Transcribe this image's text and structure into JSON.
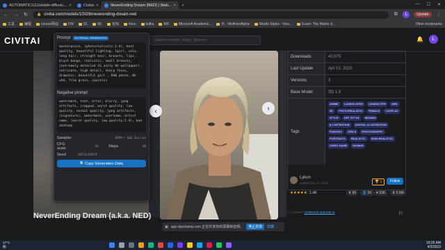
{
  "browser": {
    "tabs": [
      {
        "title": "AUTOMATIC1111/stable-diffusio..."
      },
      {
        "title": "Civitai"
      },
      {
        "title": "NeverEnding Dream (NED) | Stab..."
      }
    ],
    "url": "civitai.com/models/10028/neverending-dream-ned",
    "update_label": "Update",
    "profile_initial": "L",
    "bookmarks": [
      "工具",
      "编程",
      "course网站",
      "FW",
      "DL",
      "ML",
      "论坛",
      "linux",
      "kafka",
      "MS",
      "Microsoft Academic...",
      "r5 - WolframAlpha",
      "Studio Styles - Visu...",
      "Exam: The Matrix cl..."
    ],
    "other_bookmarks": "Other bookmarks"
  },
  "site": {
    "logo_main": "CIVITAI",
    "search_placeholder": "Search models, #tags, @users",
    "user_initial": "L"
  },
  "popover": {
    "prompt_label": "Prompt",
    "prompt_badge": "EXTERNAL GENERATION",
    "prompt_text": "masterpiece, (photorealistic:1.4), best quality, beautiful lighting, 1girl, solo, long hair, straight hair, breasts, lips, blunt bangs, realistic, small breasts, (extremely detailed CG unity 8k wallpaper), intricate, high detail, sharp focus, dramatic, beautiful girl , RAW photo, 8k uhd, film grain, caustics",
    "negative_label": "Negative prompt",
    "negative_text": "watermark, text, error, blurry, jpeg artifacts, cropped, worst quality, low quality, normal quality, jpeg artifacts, (signature), watermark, username, artist name, (worst quality, low quality:1.4), bad anatomy",
    "sampler_label": "Sampler",
    "sampler_value": "DPM++ SDE Karras",
    "cfg_label": "CFG scale",
    "cfg_value": "10",
    "steps_label": "Steps",
    "steps_value": "30",
    "seed_label": "Seed",
    "seed_value": "4074135879",
    "copy_button": "Copy Generation Data"
  },
  "details": {
    "rows": [
      {
        "k": "Downloads",
        "v": "40,575"
      },
      {
        "k": "Last Update",
        "v": "Apr 01, 2023"
      },
      {
        "k": "Versions",
        "v": "3"
      },
      {
        "k": "Base Model",
        "v": "SD 1.5"
      }
    ],
    "tags_label": "Tags",
    "tags": [
      "ANIME",
      "LANDSCAPES",
      "CHARACTER",
      "GIRL",
      "3D",
      "PHOTOREALISTIC",
      "FEMALE",
      "COSPLAY",
      "STYLE",
      "ART STYLE",
      "WOMAN",
      "ILLUSTRATION",
      "DIGITAL ILLUSTRATION",
      "FANTASY",
      "GIRLS",
      "PHOTOGRAPHY",
      "PORTRAITS",
      "REALISTIC",
      "SEMI REALISTIC",
      "VIDEO GAME",
      "WOMEN"
    ]
  },
  "creator": {
    "name": "Lykon",
    "joined": "Joined Dec 31, 2022",
    "badge": "1",
    "follow": "Follow",
    "rating_count": "1.4K",
    "stats": [
      "90",
      "5K",
      "93K",
      "0.6M"
    ]
  },
  "license": {
    "prefix": "License:",
    "name": "creativeml-openrail-m"
  },
  "model_title": "NeverEnding Dream (a.k.a. NED)",
  "toast": {
    "text": "app.clipchamp.com 正在共享你的屏幕和音频。",
    "stop": "停止共享",
    "hide": "隐藏"
  },
  "taskbar": {
    "weather_temp": "17°C",
    "weather_desc": "阴",
    "time": "10:26 AM",
    "date": "4/2/2023"
  },
  "colors": {
    "accent": "#228be6",
    "tag_bg": "#2b2f62",
    "button": "#1971c2",
    "bg": "#1a1b1e"
  }
}
